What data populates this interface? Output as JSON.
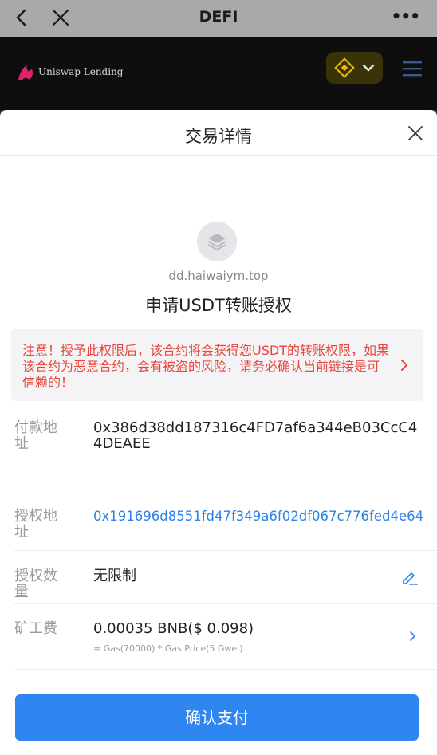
{
  "topbar": {
    "title": "DEFI",
    "more": "•••"
  },
  "appbar": {
    "brand": "Uniswap Lending"
  },
  "sheet": {
    "title": "交易详情",
    "site_url": "dd.haiwaiym.top",
    "request_title": "申请USDT转账授权",
    "warning": "注意！授予此权限后，该合约将会获得您USDT的转账权限，如果该合约为恶意合约，会有被盗的风险，请务必确认当前链接是可信赖的！",
    "rows": [
      {
        "label": "付款地址",
        "value": "0x386d38dd187316c4FD7af6a344eB03CcC44DEAEE"
      },
      {
        "label": "授权地址",
        "value": "0x191696d8551fd47f349a6f02df067c776fed4e64"
      },
      {
        "label": "授权数量",
        "value": "无限制"
      },
      {
        "label": "矿工费",
        "value": "0.00035 BNB($ 0.098)",
        "sub": "≈ Gas(70000) * Gas Price(5 Gwei)"
      }
    ],
    "confirm_label": "确认支付"
  },
  "colors": {
    "accent": "#2f86f0",
    "warning": "#e8473c",
    "link": "#2b83ea",
    "chain_badge": "#f0b90b"
  }
}
